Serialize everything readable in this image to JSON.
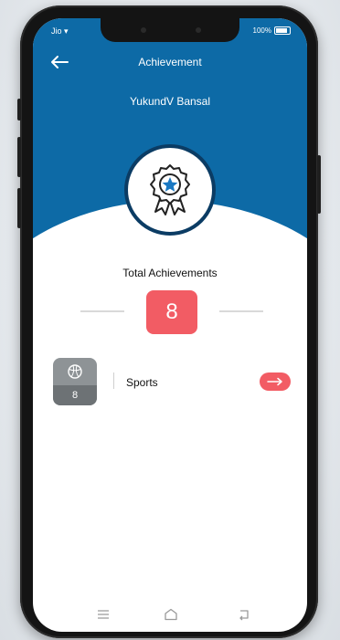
{
  "header": {
    "title": "Achievement",
    "user_name": "YukundV Bansal"
  },
  "status_bar": {
    "left_text": "Jio ▾",
    "battery_text": "100%"
  },
  "summary": {
    "total_label": "Total Achievements",
    "total_count": "8"
  },
  "categories": [
    {
      "name": "Sports",
      "count": "8",
      "icon": "ball-icon"
    }
  ],
  "icons": {
    "back": "back-arrow-icon",
    "badge": "award-ribbon-icon",
    "detail": "arrow-right-icon",
    "nav": [
      "menu-icon",
      "home-icon",
      "return-icon"
    ]
  },
  "colors": {
    "header_blue": "#0d6aa6",
    "badge_border": "#0b3c64",
    "accent_red": "#f25c64",
    "tile_gray": "#8e9396"
  }
}
